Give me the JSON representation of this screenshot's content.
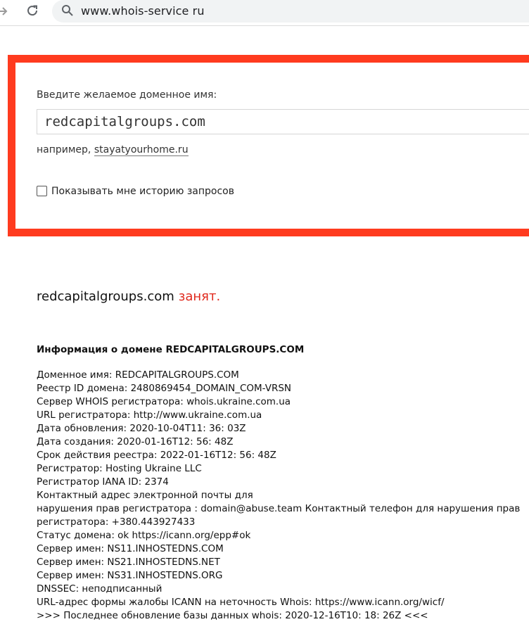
{
  "browser": {
    "url": "www.whois-service ru"
  },
  "search": {
    "prompt_label": "Введите желаемое доменное имя:",
    "input_value": "redcapitalgroups.com",
    "example_prefix": "например,",
    "example_link": "stayatyourhome.ru",
    "history_checkbox_label": "Показывать мне историю запросов",
    "history_checked": false,
    "frame_color": "#ff3b1f"
  },
  "result": {
    "domain": "redcapitalgroups.com",
    "status": "занят.",
    "status_color": "#e0281c",
    "info_title": "Информация о домене REDCAPITALGROUPS.COM",
    "lines": [
      "Доменное имя: REDCAPITALGROUPS.COM",
      "Реестр ID домена: 2480869454_DOMAIN_COM-VRSN",
      "Сервер WHOIS регистратора: whois.ukraine.com.ua",
      "URL регистратора: http://www.ukraine.com.ua",
      "Дата обновления: 2020-10-04T11: 36: 03Z",
      "Дата создания: 2020-01-16T12: 56: 48Z",
      "Срок действия реестра: 2022-01-16T12: 56: 48Z",
      "Регистратор: Hosting Ukraine LLC",
      "Регистратор IANA ID: 2374",
      "Контактный адрес электронной почты для",
      "нарушения прав регистратора : domain@abuse.team Контактный телефон для нарушения прав",
      "регистратора: +380.443927433",
      "Статус домена: ok https://icann.org/epp#ok",
      "Сервер имен: NS11.INHOSTEDNS.COM",
      "Сервер имен: NS21.INHOSTEDNS.NET",
      "Сервер имен: NS31.INHOSTEDNS.ORG",
      "DNSSEC: неподписанный",
      "URL-адрес формы жалобы ICANN на неточность Whois: https://www.icann.org/wicf/",
      ">>> Последнее обновление базы данных whois: 2020-12-16T10: 18: 26Z <<<"
    ]
  },
  "icons": [
    "forward-arrow-icon",
    "reload-icon",
    "search-icon"
  ]
}
